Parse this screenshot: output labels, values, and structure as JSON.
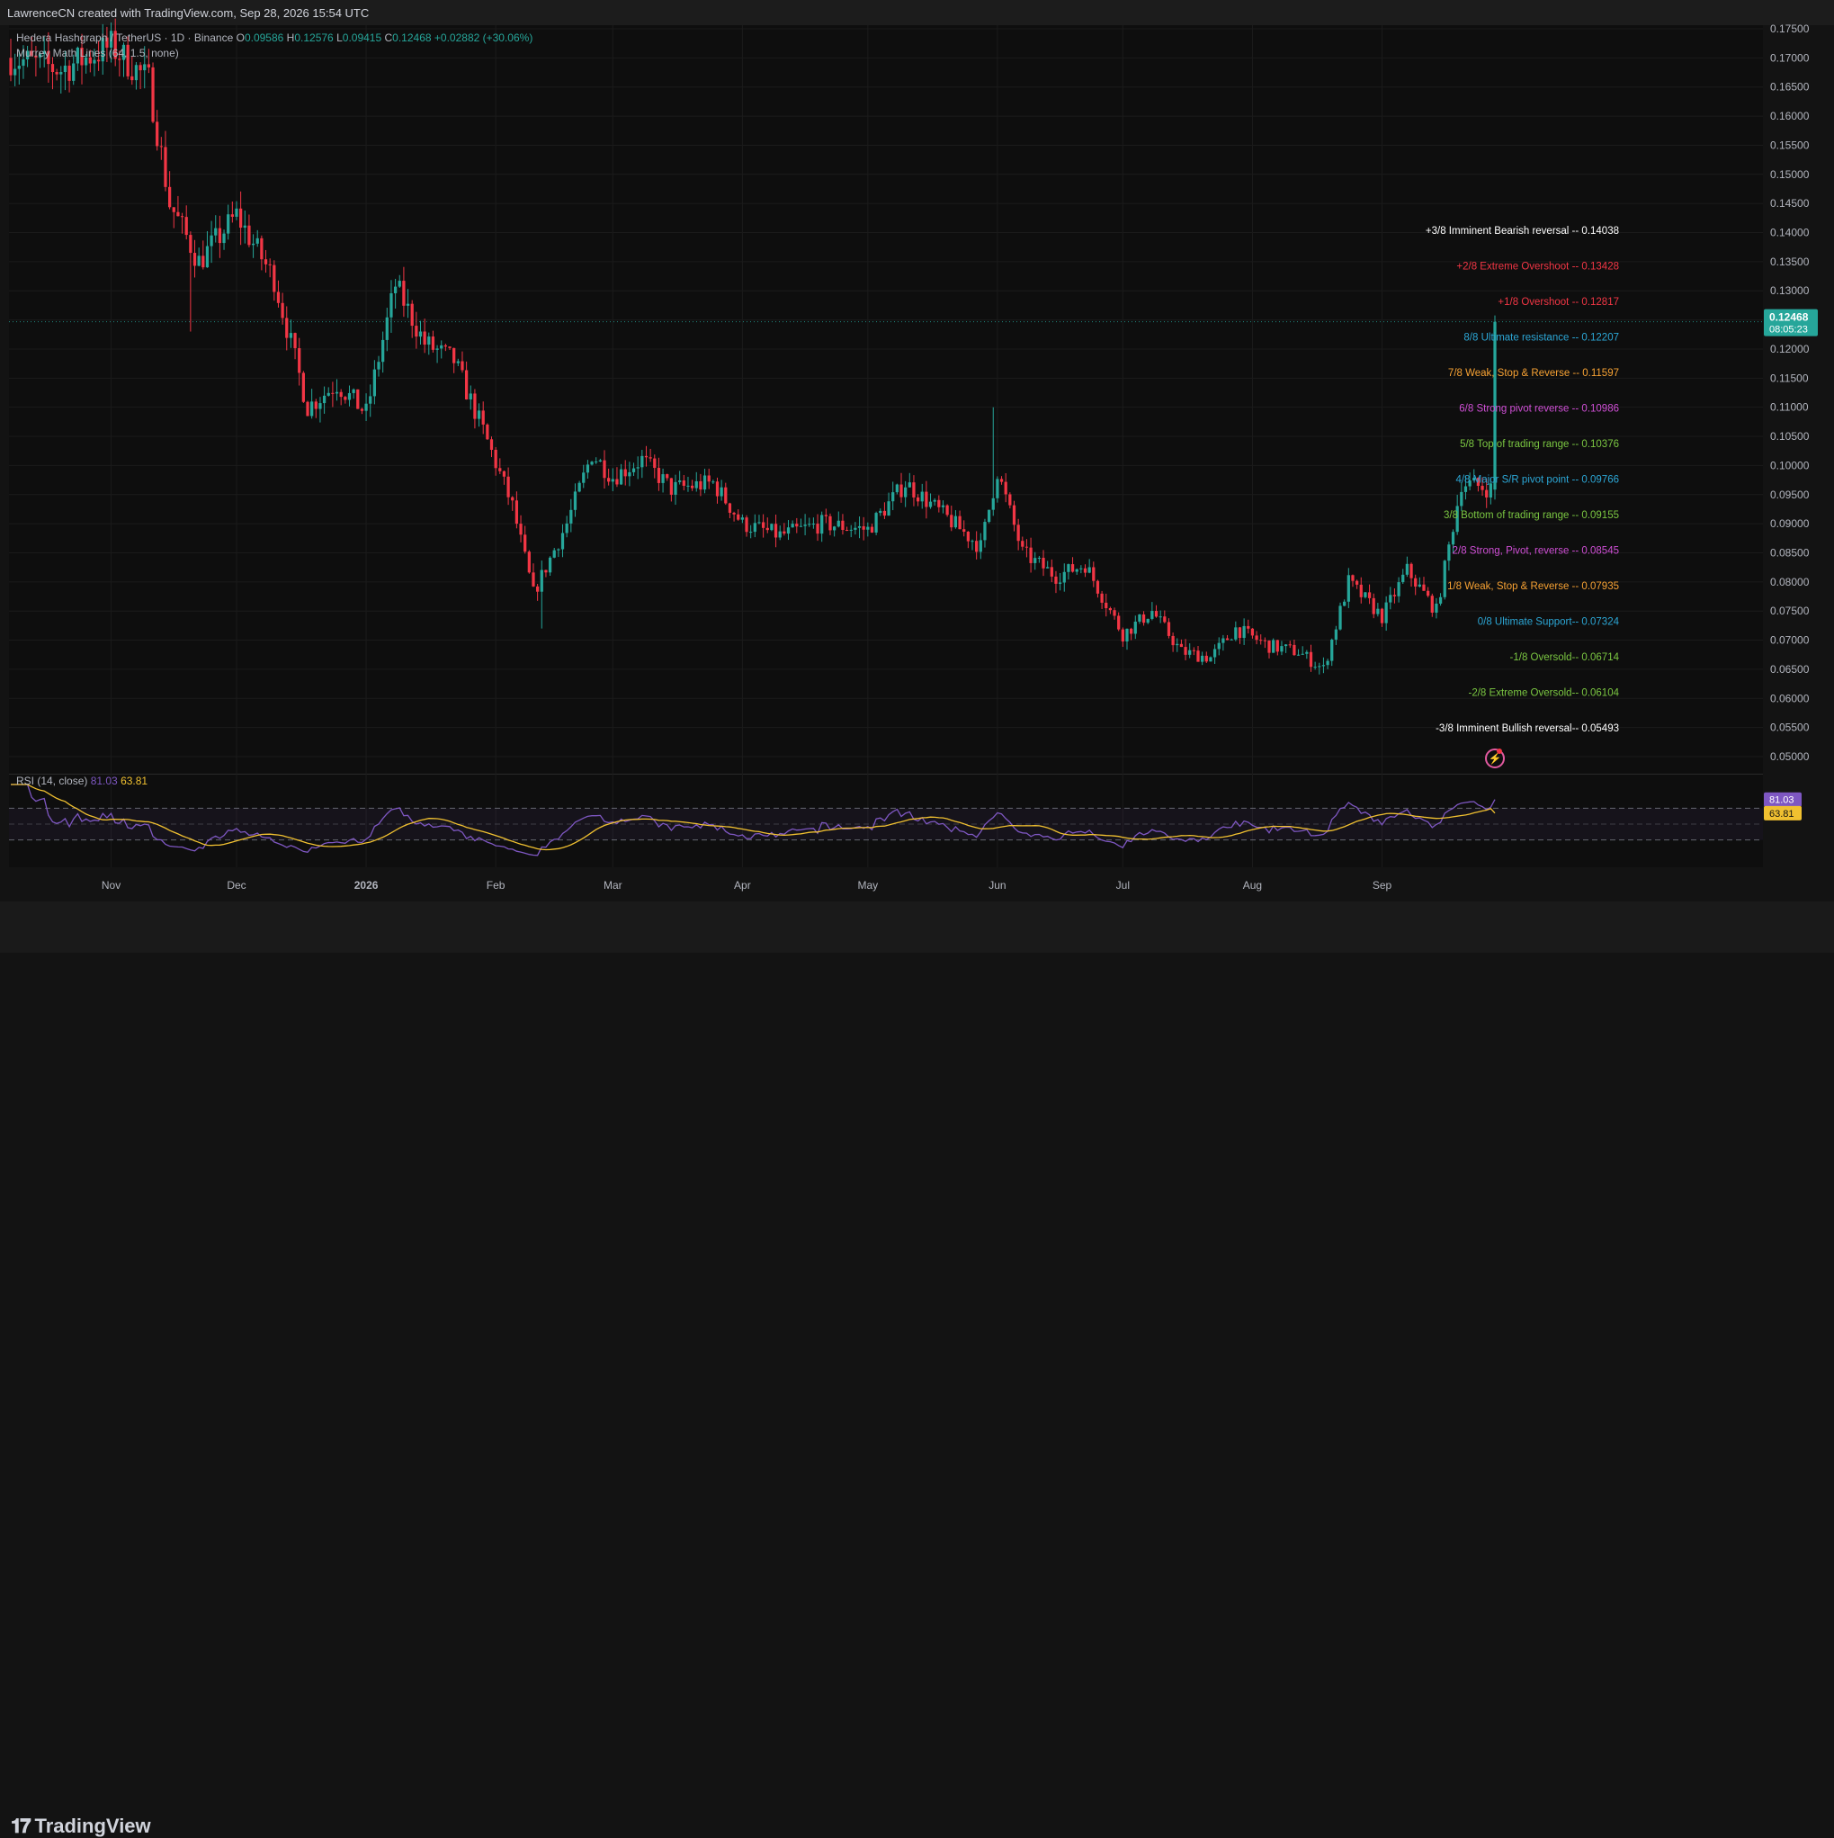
{
  "header": {
    "author_line": "LawrenceCN created with TradingView.com, Sep 28, 2026 15:54 UTC"
  },
  "symbol": {
    "name": "Hedera Hashgraph / TetherUS · 1D · Binance",
    "open_label": "O",
    "open": "0.09586",
    "high_label": "H",
    "high": "0.12576",
    "low_label": "L",
    "low": "0.09415",
    "close_label": "C",
    "close": "0.12468",
    "change": "+0.02882 (+30.06%)"
  },
  "indicator": {
    "name": "Murrey Math Lines (64, 1.5, none)"
  },
  "rsi": {
    "name": "RSI (14, close)",
    "value": "81.03",
    "ma_value": "63.81"
  },
  "price_tag": {
    "price": "0.12468",
    "countdown": "08:05:23"
  },
  "branding": {
    "logo_text": "TradingView"
  },
  "colors": {
    "up": "#26a69a",
    "down": "#f23645",
    "rsi_line": "#7e57c2",
    "rsi_ma": "#f0c030",
    "background": "#0e0e0e"
  },
  "chart_data": {
    "type": "candlestick",
    "x_range": [
      "2025-10-08",
      "2026-09-28"
    ],
    "ylim": [
      0.05,
      0.175
    ],
    "y_ticks": [
      "0.17500",
      "0.17000",
      "0.16500",
      "0.16000",
      "0.15500",
      "0.15000",
      "0.14500",
      "0.14000",
      "0.13500",
      "0.13000",
      "0.12500",
      "0.12000",
      "0.11500",
      "0.11000",
      "0.10500",
      "0.10000",
      "0.09500",
      "0.09000",
      "0.08500",
      "0.08000",
      "0.07500",
      "0.07000",
      "0.06500",
      "0.06000",
      "0.05500",
      "0.05000"
    ],
    "x_ticks": [
      {
        "label": "Nov",
        "date": "2025-11-01"
      },
      {
        "label": "Dec",
        "date": "2025-12-01"
      },
      {
        "label": "2026",
        "date": "2026-01-01"
      },
      {
        "label": "Feb",
        "date": "2026-02-01"
      },
      {
        "label": "Mar",
        "date": "2026-03-01"
      },
      {
        "label": "Apr",
        "date": "2026-04-01"
      },
      {
        "label": "May",
        "date": "2026-05-01"
      },
      {
        "label": "Jun",
        "date": "2026-06-01"
      },
      {
        "label": "Jul",
        "date": "2026-07-01"
      },
      {
        "label": "Aug",
        "date": "2026-08-01"
      },
      {
        "label": "Sep",
        "date": "2026-09-01"
      }
    ],
    "price_path": [
      {
        "date": "2025-10-08",
        "price": 0.17
      },
      {
        "date": "2025-10-20",
        "price": 0.168
      },
      {
        "date": "2025-11-01",
        "price": 0.172
      },
      {
        "date": "2025-11-10",
        "price": 0.166
      },
      {
        "date": "2025-11-15",
        "price": 0.145
      },
      {
        "date": "2025-11-22",
        "price": 0.135
      },
      {
        "date": "2025-12-01",
        "price": 0.143
      },
      {
        "date": "2025-12-10",
        "price": 0.132
      },
      {
        "date": "2025-12-18",
        "price": 0.11
      },
      {
        "date": "2025-12-25",
        "price": 0.114
      },
      {
        "date": "2026-01-01",
        "price": 0.109
      },
      {
        "date": "2026-01-08",
        "price": 0.131
      },
      {
        "date": "2026-01-15",
        "price": 0.121
      },
      {
        "date": "2026-01-22",
        "price": 0.118
      },
      {
        "date": "2026-01-29",
        "price": 0.106
      },
      {
        "date": "2026-02-05",
        "price": 0.093
      },
      {
        "date": "2026-02-10",
        "price": 0.078
      },
      {
        "date": "2026-02-18",
        "price": 0.09
      },
      {
        "date": "2026-02-24",
        "price": 0.102
      },
      {
        "date": "2026-03-01",
        "price": 0.098
      },
      {
        "date": "2026-03-08",
        "price": 0.101
      },
      {
        "date": "2026-03-15",
        "price": 0.096
      },
      {
        "date": "2026-03-25",
        "price": 0.097
      },
      {
        "date": "2026-04-01",
        "price": 0.09
      },
      {
        "date": "2026-04-10",
        "price": 0.088
      },
      {
        "date": "2026-04-20",
        "price": 0.09
      },
      {
        "date": "2026-05-01",
        "price": 0.089
      },
      {
        "date": "2026-05-10",
        "price": 0.097
      },
      {
        "date": "2026-05-20",
        "price": 0.091
      },
      {
        "date": "2026-05-28",
        "price": 0.086
      },
      {
        "date": "2026-06-01",
        "price": 0.099
      },
      {
        "date": "2026-06-07",
        "price": 0.085
      },
      {
        "date": "2026-06-15",
        "price": 0.081
      },
      {
        "date": "2026-06-22",
        "price": 0.083
      },
      {
        "date": "2026-07-01",
        "price": 0.071
      },
      {
        "date": "2026-07-08",
        "price": 0.075
      },
      {
        "date": "2026-07-15",
        "price": 0.068
      },
      {
        "date": "2026-07-22",
        "price": 0.067
      },
      {
        "date": "2026-07-28",
        "price": 0.072
      },
      {
        "date": "2026-08-05",
        "price": 0.069
      },
      {
        "date": "2026-08-12",
        "price": 0.068
      },
      {
        "date": "2026-08-18",
        "price": 0.065
      },
      {
        "date": "2026-08-24",
        "price": 0.08
      },
      {
        "date": "2026-09-01",
        "price": 0.074
      },
      {
        "date": "2026-09-07",
        "price": 0.082
      },
      {
        "date": "2026-09-14",
        "price": 0.075
      },
      {
        "date": "2026-09-20",
        "price": 0.097
      },
      {
        "date": "2026-09-27",
        "price": 0.096
      },
      {
        "date": "2026-09-28",
        "price": 0.12468
      }
    ],
    "spikes": [
      {
        "date": "2025-11-20",
        "low": 0.123
      },
      {
        "date": "2026-02-12",
        "low": 0.072
      },
      {
        "date": "2026-05-31",
        "high": 0.11
      },
      {
        "date": "2026-09-28",
        "high": 0.12576
      }
    ],
    "current_price": 0.12468,
    "murrey_lines": [
      {
        "label": "+3/8 Imminent Bearish reversal --",
        "value": 0.14038,
        "value_text": "0.14038",
        "color": "#ffffff"
      },
      {
        "label": "+2/8 Extreme Overshoot --",
        "value": 0.13428,
        "value_text": "0.13428",
        "color": "#f23645"
      },
      {
        "label": "+1/8 Overshoot --",
        "value": 0.12817,
        "value_text": "0.12817",
        "color": "#f23645"
      },
      {
        "label": "8/8 Ultimate resistance --",
        "value": 0.12207,
        "value_text": "0.12207",
        "color": "#2ca7d6"
      },
      {
        "label": "7/8 Weak, Stop & Reverse --",
        "value": 0.11597,
        "value_text": "0.11597",
        "color": "#f7a234"
      },
      {
        "label": "6/8 Strong pivot reverse --",
        "value": 0.10986,
        "value_text": "0.10986",
        "color": "#d04fd6"
      },
      {
        "label": "5/8 Top of trading range --",
        "value": 0.10376,
        "value_text": "0.10376",
        "color": "#7bc742"
      },
      {
        "label": "4/8 Major S/R pivot point --",
        "value": 0.09766,
        "value_text": "0.09766",
        "color": "#2ca7d6"
      },
      {
        "label": "3/8 Bottom of trading range --",
        "value": 0.09155,
        "value_text": "0.09155",
        "color": "#7bc742"
      },
      {
        "label": "2/8 Strong, Pivot, reverse --",
        "value": 0.08545,
        "value_text": "0.08545",
        "color": "#d04fd6"
      },
      {
        "label": "1/8 Weak, Stop & Reverse --",
        "value": 0.07935,
        "value_text": "0.07935",
        "color": "#f7a234"
      },
      {
        "label": "0/8 Ultimate Support--",
        "value": 0.07324,
        "value_text": "0.07324",
        "color": "#2ca7d6"
      },
      {
        "label": "-1/8 Oversold--",
        "value": 0.06714,
        "value_text": "0.06714",
        "color": "#7bc742"
      },
      {
        "label": "-2/8 Extreme Oversold--",
        "value": 0.06104,
        "value_text": "0.06104",
        "color": "#7bc742"
      },
      {
        "label": "-3/8 Imminent Bullish reversal--",
        "value": 0.05493,
        "value_text": "0.05493",
        "color": "#ffffff"
      }
    ],
    "rsi_panel": {
      "ylim": [
        0,
        100
      ],
      "bands": [
        70,
        50,
        30
      ],
      "last_rsi": 81.03,
      "last_ma": 63.81
    }
  }
}
